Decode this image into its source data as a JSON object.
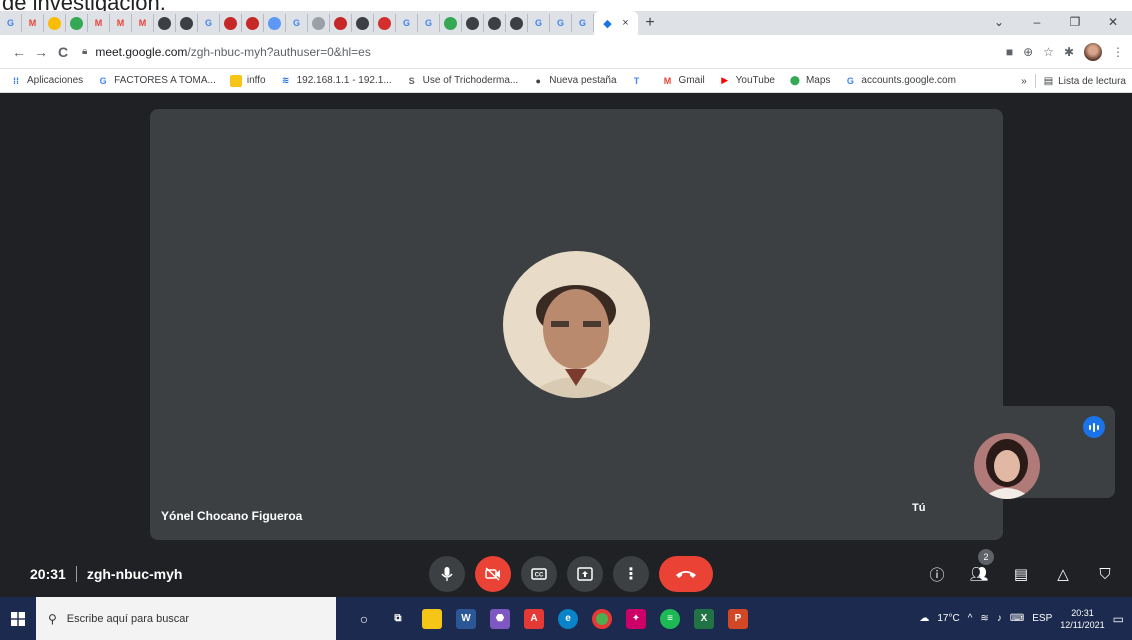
{
  "caption": "de investigación.",
  "browser": {
    "url_host": "meet.google.com",
    "url_path": "/zgh-nbuc-myh?authuser=0&hl=es",
    "tab_glyphs": [
      "G",
      "M",
      "",
      "",
      "M",
      "M",
      "M",
      "",
      "",
      "G",
      "",
      "",
      "",
      "G",
      "",
      "",
      "",
      "",
      "G",
      "G",
      "",
      "",
      "",
      "",
      "G",
      "G",
      "G"
    ],
    "close_tab": "×",
    "new_tab": "+",
    "win_minimize": "–",
    "win_restore": "❐",
    "win_close": "✕",
    "back": "←",
    "forward": "→",
    "reload": "C",
    "more_bookmarks": "»"
  },
  "bookmarks": [
    {
      "label": "Aplicaciones",
      "icon": "apps-grid-icon",
      "glyph": "⁞⁞",
      "color": "#1a73e8"
    },
    {
      "label": "FACTORES A TOMA...",
      "icon": "google-icon",
      "glyph": "G",
      "color": "#4285f4"
    },
    {
      "label": "inffo",
      "icon": "folder-icon",
      "glyph": "",
      "color": "#f5c518"
    },
    {
      "label": "192.168.1.1 - 192.1...",
      "icon": "wifi-icon",
      "glyph": "≋",
      "color": "#1a73e8"
    },
    {
      "label": "Use of Trichoderma...",
      "icon": "link-icon",
      "glyph": "S",
      "color": "#5f6368"
    },
    {
      "label": "Nueva pestaña",
      "icon": "globe-icon",
      "glyph": "●",
      "color": "#3c4043"
    },
    {
      "label": "",
      "icon": "translate-icon",
      "glyph": "T",
      "color": "#4285f4"
    },
    {
      "label": "Gmail",
      "icon": "gmail-icon",
      "glyph": "M",
      "color": "#ea4335"
    },
    {
      "label": "YouTube",
      "icon": "youtube-icon",
      "glyph": "▶",
      "color": "#ff0000"
    },
    {
      "label": "Maps",
      "icon": "maps-icon",
      "glyph": "⬤",
      "color": "#34a853"
    },
    {
      "label": "accounts.google.com",
      "icon": "google-icon",
      "glyph": "G",
      "color": "#4285f4"
    }
  ],
  "reading_list": "Lista de lectura",
  "meet": {
    "main_participant": "Yónel Chocano Figueroa",
    "self_name": "Tú",
    "time": "20:31",
    "meeting_code": "zgh-nbuc-myh",
    "people_count": "2"
  },
  "taskbar": {
    "search_placeholder": "Escribe aquí para buscar",
    "weather": "17°C",
    "language": "ESP",
    "time": "20:31",
    "date": "12/11/2021"
  }
}
